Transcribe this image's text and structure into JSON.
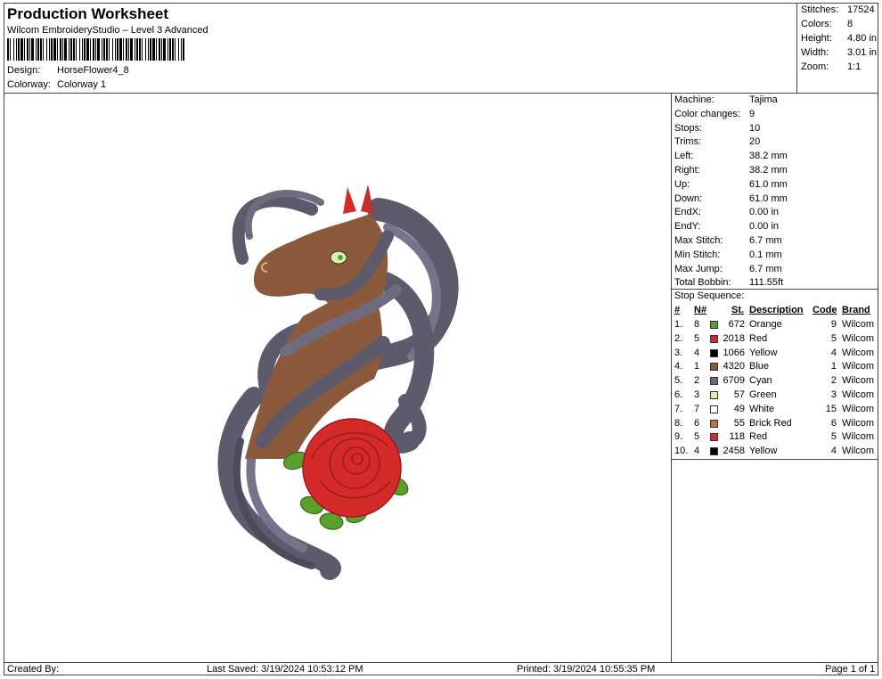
{
  "header": {
    "title": "Production Worksheet",
    "software": "Wilcom EmbroideryStudio – Level 3 Advanced",
    "design_label": "Design:",
    "design_value": "HorseFlower4_8",
    "colorway_label": "Colorway:",
    "colorway_value": "Colorway 1"
  },
  "stats": [
    {
      "label": "Stitches:",
      "value": "17524"
    },
    {
      "label": "Colors:",
      "value": "8"
    },
    {
      "label": "Height:",
      "value": "4.80 in"
    },
    {
      "label": "Width:",
      "value": "3.01 in"
    },
    {
      "label": "Zoom:",
      "value": "1:1"
    }
  ],
  "specs": [
    {
      "label": "Machine:",
      "value": "Tajima"
    },
    {
      "label": "Color changes:",
      "value": "9"
    },
    {
      "label": "Stops:",
      "value": "10"
    },
    {
      "label": "Trims:",
      "value": "20"
    },
    {
      "label": "Left:",
      "value": "38.2 mm"
    },
    {
      "label": "Right:",
      "value": "38.2 mm"
    },
    {
      "label": "Up:",
      "value": "61.0 mm"
    },
    {
      "label": "Down:",
      "value": "61.0 mm"
    },
    {
      "label": "EndX:",
      "value": "0.00 in"
    },
    {
      "label": "EndY:",
      "value": "0.00 in"
    },
    {
      "label": "Max Stitch:",
      "value": "6.7 mm"
    },
    {
      "label": "Min Stitch:",
      "value": "0.1 mm"
    },
    {
      "label": "Max Jump:",
      "value": "6.7 mm"
    },
    {
      "label": "Total Bobbin:",
      "value": "111.55ft"
    }
  ],
  "sequence": {
    "title": "Stop Sequence:",
    "headers": {
      "num": "#",
      "n": "N#",
      "st": "St.",
      "desc": "Description",
      "code": "Code",
      "brand": "Brand"
    },
    "rows": [
      {
        "num": "1.",
        "n": "8",
        "color": "#5aa02c",
        "st": "672",
        "desc": "Orange",
        "code": "9",
        "brand": "Wilcom"
      },
      {
        "num": "2.",
        "n": "5",
        "color": "#d42a2a",
        "st": "2018",
        "desc": "Red",
        "code": "5",
        "brand": "Wilcom"
      },
      {
        "num": "3.",
        "n": "4",
        "color": "#000000",
        "st": "1066",
        "desc": "Yellow",
        "code": "4",
        "brand": "Wilcom"
      },
      {
        "num": "4.",
        "n": "1",
        "color": "#8b5a3c",
        "st": "4320",
        "desc": "Blue",
        "code": "1",
        "brand": "Wilcom"
      },
      {
        "num": "5.",
        "n": "2",
        "color": "#6b6b7a",
        "st": "6709",
        "desc": "Cyan",
        "code": "2",
        "brand": "Wilcom"
      },
      {
        "num": "6.",
        "n": "3",
        "color": "#d9f0b0",
        "st": "57",
        "desc": "Green",
        "code": "3",
        "brand": "Wilcom"
      },
      {
        "num": "7.",
        "n": "7",
        "color": "#ffffff",
        "st": "49",
        "desc": "White",
        "code": "15",
        "brand": "Wilcom"
      },
      {
        "num": "8.",
        "n": "6",
        "color": "#c8703c",
        "st": "55",
        "desc": "Brick Red",
        "code": "6",
        "brand": "Wilcom"
      },
      {
        "num": "9.",
        "n": "5",
        "color": "#d42a2a",
        "st": "118",
        "desc": "Red",
        "code": "5",
        "brand": "Wilcom"
      },
      {
        "num": "10.",
        "n": "4",
        "color": "#000000",
        "st": "2458",
        "desc": "Yellow",
        "code": "4",
        "brand": "Wilcom"
      }
    ]
  },
  "footer": {
    "created_by": "Created By:",
    "last_saved": "Last Saved: 3/19/2024 10:53:12 PM",
    "printed": "Printed: 3/19/2024 10:55:35 PM",
    "page": "Page 1 of 1"
  },
  "colors": {
    "mane": "#5c5a6b",
    "coat": "#8b5a3c",
    "rose": "#d42a2a",
    "leaf": "#5aa02c",
    "eye": "#d9f0b0"
  }
}
